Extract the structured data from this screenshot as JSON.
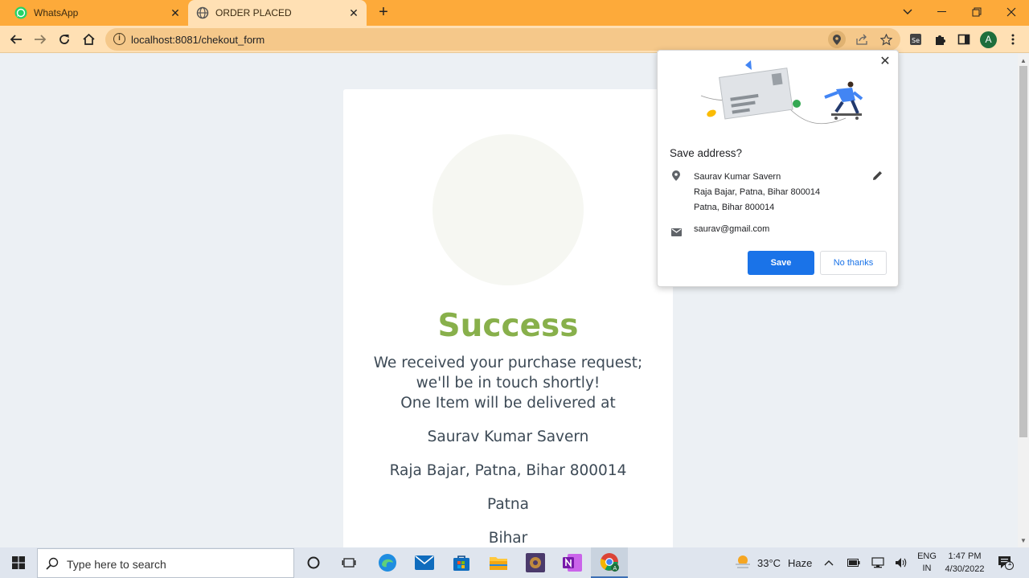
{
  "browser": {
    "tabs": [
      {
        "title": "WhatsApp",
        "icon": "whatsapp-icon"
      },
      {
        "title": "ORDER PLACED",
        "icon": "globe-icon"
      }
    ],
    "url": "localhost:8081/chekout_form",
    "profile_initial": "A"
  },
  "page": {
    "heading": "Success",
    "message_line1": "We received your purchase request;",
    "message_line2": "we'll be in touch shortly!",
    "message_line3": "One Item will be delivered at",
    "name": "Saurav Kumar Savern",
    "address": "Raja Bajar, Patna, Bihar 800014",
    "city": "Patna",
    "state": "Bihar"
  },
  "popup": {
    "title": "Save address?",
    "address_lines": [
      "Saurav Kumar Savern",
      "Raja Bajar, Patna, Bihar 800014",
      "Patna, Bihar 800014"
    ],
    "email": "saurav@gmail.com",
    "save_label": "Save",
    "no_thanks_label": "No thanks"
  },
  "taskbar": {
    "search_placeholder": "Type here to search",
    "weather_temp": "33°C",
    "weather_desc": "Haze",
    "lang_top": "ENG",
    "lang_bottom": "IN",
    "time": "1:47 PM",
    "date": "4/30/2022",
    "notification_count": "1"
  },
  "colors": {
    "tabstrip": "#fdaa3a",
    "toolbar": "#ffe0b4",
    "success_green": "#88b04b",
    "save_blue": "#1a73e8"
  }
}
